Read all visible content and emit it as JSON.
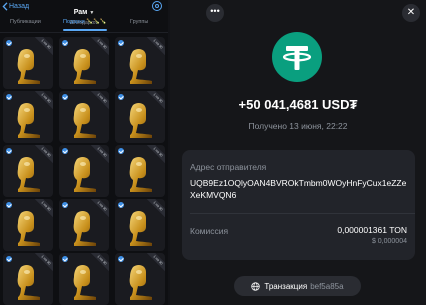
{
  "gifts_screen": {
    "back_label": "Назад",
    "title": "Рам",
    "subtitle": "30 подарков",
    "tabs": [
      {
        "label": "Публикации"
      },
      {
        "label": "Подарки 🍾🍾🍾"
      },
      {
        "label": "Группы"
      }
    ],
    "gift_badge": "1 на 30",
    "gift_count_visible": 15
  },
  "transaction": {
    "amount": "+50 041,4681 USD₮",
    "date": "Получено 13 июня, 22:22",
    "sender_label": "Адрес отправителя",
    "sender_address": "UQB9Ez1OQlyOAN4BVROkTmbm0WOyHnFyCux1eZZeXeKMVQN6",
    "fee_label": "Комиссия",
    "fee_value": "0,000001361 TON",
    "fee_usd": "$ 0,000004",
    "tx_label": "Транзакция",
    "tx_hash": "bef5a85a"
  },
  "colors": {
    "accent": "#5aa8f5",
    "token_green": "#0a9f7f",
    "background": "#151619"
  },
  "icons": [
    "chevron-left-icon",
    "settings-icon",
    "gift-icon",
    "check-badge-icon",
    "more-icon",
    "close-icon",
    "tether-icon",
    "globe-icon"
  ]
}
